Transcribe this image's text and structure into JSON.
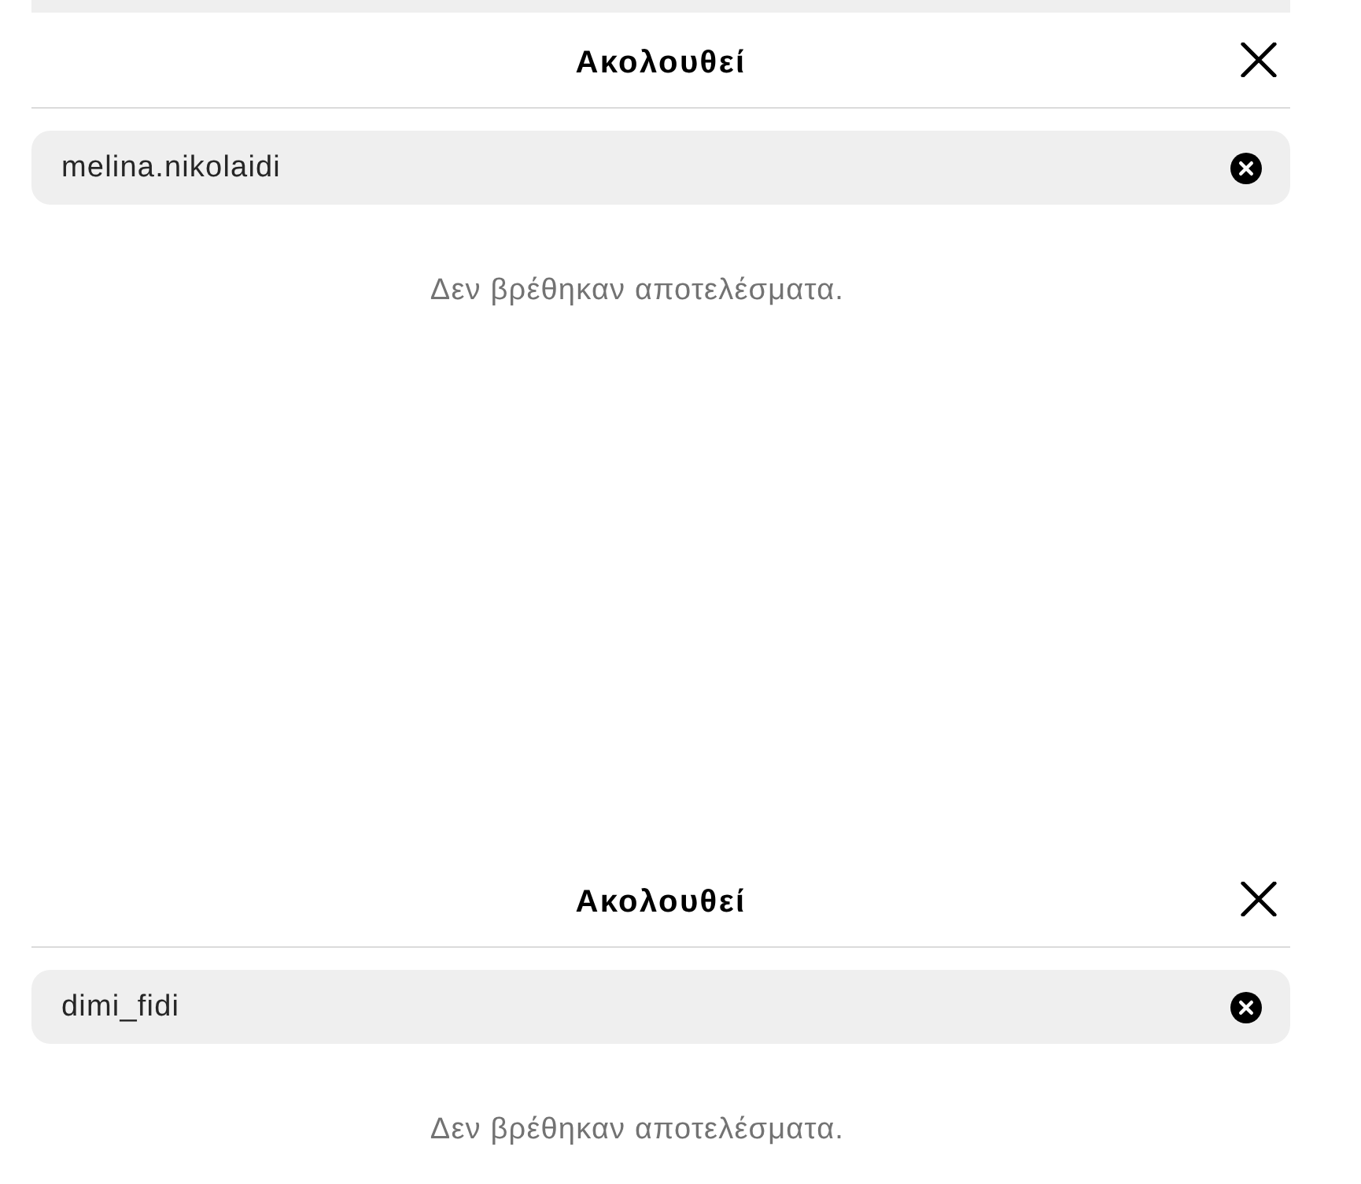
{
  "panels": [
    {
      "title": "Ακολουθεί",
      "search": {
        "value": "melina.nikolaidi"
      },
      "empty_message": "Δεν βρέθηκαν αποτελέσματα."
    },
    {
      "title": "Ακολουθεί",
      "search": {
        "value": "dimi_fidi"
      },
      "empty_message": "Δεν βρέθηκαν αποτελέσματα."
    }
  ]
}
